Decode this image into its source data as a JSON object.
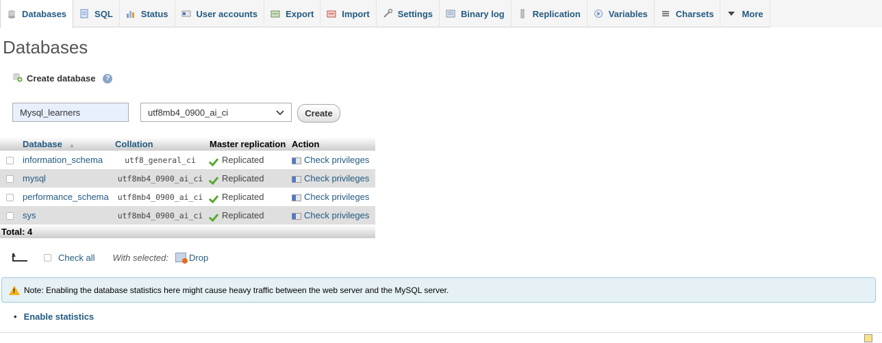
{
  "tabs": [
    {
      "label": "Databases",
      "icon": "database-icon",
      "active": true
    },
    {
      "label": "SQL",
      "icon": "sql-icon"
    },
    {
      "label": "Status",
      "icon": "status-icon"
    },
    {
      "label": "User accounts",
      "icon": "user-accounts-icon"
    },
    {
      "label": "Export",
      "icon": "export-icon"
    },
    {
      "label": "Import",
      "icon": "import-icon"
    },
    {
      "label": "Settings",
      "icon": "wrench-icon"
    },
    {
      "label": "Binary log",
      "icon": "binary-log-icon"
    },
    {
      "label": "Replication",
      "icon": "replication-icon"
    },
    {
      "label": "Variables",
      "icon": "variables-icon"
    },
    {
      "label": "Charsets",
      "icon": "charsets-icon"
    },
    {
      "label": "More",
      "icon": "caret-down-icon"
    }
  ],
  "page_title": "Databases",
  "create_db": {
    "heading": "Create database",
    "name_value": "Mysql_learners",
    "collation_selected": "utf8mb4_0900_ai_ci",
    "create_label": "Create"
  },
  "table": {
    "headers": {
      "database": "Database",
      "collation": "Collation",
      "master_replication": "Master replication",
      "action": "Action"
    },
    "sort_indicator": "▲",
    "rows": [
      {
        "name": "information_schema",
        "collation": "utf8_general_ci",
        "replication": "Replicated",
        "action": "Check privileges"
      },
      {
        "name": "mysql",
        "collation": "utf8mb4_0900_ai_ci",
        "replication": "Replicated",
        "action": "Check privileges"
      },
      {
        "name": "performance_schema",
        "collation": "utf8mb4_0900_ai_ci",
        "replication": "Replicated",
        "action": "Check privileges"
      },
      {
        "name": "sys",
        "collation": "utf8mb4_0900_ai_ci",
        "replication": "Replicated",
        "action": "Check privileges"
      }
    ],
    "total": "Total: 4"
  },
  "bulk": {
    "check_all": "Check all",
    "with_selected": "With selected:",
    "drop": "Drop"
  },
  "notice": "Note: Enabling the database statistics here might cause heavy traffic between the web server and the MySQL server.",
  "enable_stats": "Enable statistics",
  "colors": {
    "link": "#235a81",
    "row_alt": "#dfdfdf",
    "notice_bg": "#e5f1f5",
    "notice_border": "#9fc9d7",
    "warn": "#f3b21b",
    "check": "#5aa832"
  }
}
